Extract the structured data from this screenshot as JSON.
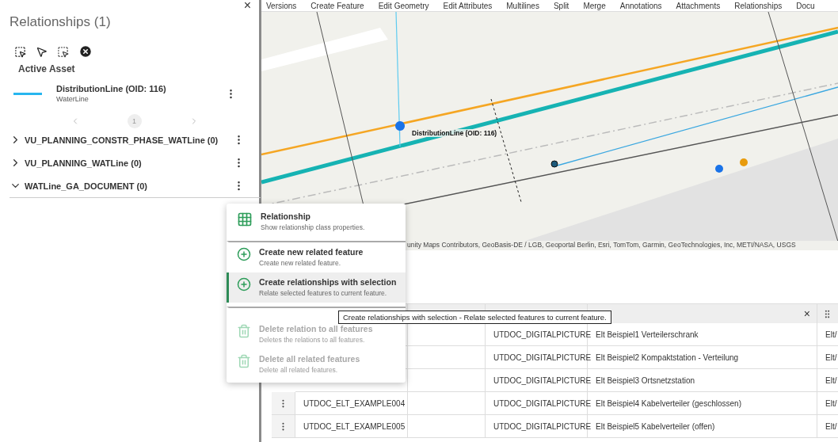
{
  "panel": {
    "title": "Relationships (1)",
    "close": "×",
    "section_label": "Active Asset",
    "asset": {
      "name": "DistributionLine (OID: 116)",
      "subtitle": "WaterLine"
    },
    "pager": {
      "page": "1"
    },
    "groups": [
      {
        "label": "VU_PLANNING_CONSTR_PHASE_WATLine (0)",
        "expanded": false
      },
      {
        "label": "VU_PLANNING_WATLine (0)",
        "expanded": false
      },
      {
        "label": "WATLine_GA_DOCUMENT (0)",
        "expanded": true
      }
    ]
  },
  "toolbar": {
    "items": [
      "Versions",
      "Create Feature",
      "Edit Geometry",
      "Edit Attributes",
      "Multilines",
      "Split",
      "Merge",
      "Annotations",
      "Attachments",
      "Relationships",
      "Docu"
    ]
  },
  "map": {
    "feature_label": "DistributionLine (OID: 116)",
    "attribution": "unity Maps Contributors, GeoBasis-DE / LGB, Geoportal Berlin, Esri, TomTom, Garmin, GeoTechnologies, Inc, METI/NASA, USGS"
  },
  "context_menu": {
    "items": [
      {
        "kind": "properties",
        "title": "Relationship",
        "description": "Show relationship class properties.",
        "disabled": false,
        "selected": false
      },
      {
        "kind": "create",
        "title": "Create new related feature",
        "description": "Create new related feature.",
        "disabled": false,
        "selected": false
      },
      {
        "kind": "create",
        "title": "Create relationships with selection",
        "description": "Relate selected features to current feature.",
        "disabled": false,
        "selected": true
      },
      {
        "kind": "delete",
        "title": "Delete relation to all features",
        "description": "Deletes the relations to all features.",
        "disabled": true,
        "selected": false
      },
      {
        "kind": "delete",
        "title": "Delete all related features",
        "description": "Delete all related features.",
        "disabled": true,
        "selected": false
      }
    ]
  },
  "tooltip": "Create relationships with selection - Relate selected features to current feature.",
  "table": {
    "close": "×",
    "rows": [
      {
        "type": "UTDOC_DIGITALPICTURE",
        "description": "Elt Beispiel1 Verteilerschrank",
        "column_6": "Elt/"
      },
      {
        "type": "UTDOC_DIGITALPICTURE",
        "description": "Elt Beispiel2 Kompaktstation - Verteilung",
        "column_6": "Elt/"
      },
      {
        "type": "UTDOC_DIGITALPICTURE",
        "description": "Elt Beispiel3 Ortsnetzstation",
        "column_6": "Elt/"
      },
      {
        "name": "UTDOC_ELT_EXAMPLE004",
        "type": "UTDOC_DIGITALPICTURE",
        "description": "Elt Beispiel4 Kabelverteiler (geschlossen)",
        "column_6": "Elt/"
      },
      {
        "name": "UTDOC_ELT_EXAMPLE005",
        "type": "UTDOC_DIGITALPICTURE",
        "description": "Elt Beispiel5 Kabelverteiler (offen)",
        "column_6": "Elt/"
      }
    ]
  }
}
